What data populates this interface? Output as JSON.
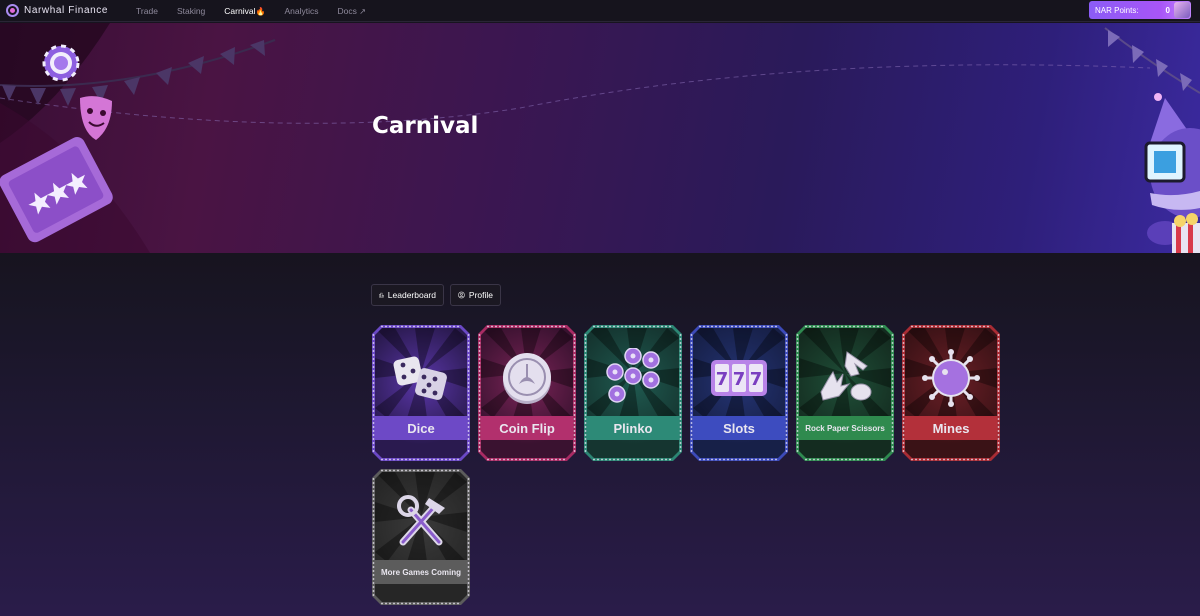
{
  "app": {
    "name": "Narwhal Finance"
  },
  "nav": {
    "links": [
      {
        "label": "Trade"
      },
      {
        "label": "Staking"
      },
      {
        "label": "Carnival"
      },
      {
        "label": "Analytics"
      },
      {
        "label": "Docs"
      }
    ],
    "active": "Carnival",
    "points_label": "NAR Points:",
    "points_value": "0"
  },
  "banner": {
    "title": "Carnival"
  },
  "actions": {
    "leaderboard": "Leaderboard",
    "profile": "Profile"
  },
  "games": [
    {
      "label": "Dice",
      "icon": "dice-icon",
      "color": "#7a4fd6"
    },
    {
      "label": "Coin Flip",
      "icon": "coin-icon",
      "color": "#b8306e"
    },
    {
      "label": "Plinko",
      "icon": "plinko-chips-icon",
      "color": "#2f8a78"
    },
    {
      "label": "Slots",
      "icon": "slot-machine-icon",
      "color": "#3b4ac0"
    },
    {
      "label": "Rock Paper Scissors",
      "icon": "hand-gestures-icon",
      "color": "#2f8a4e"
    },
    {
      "label": "Mines",
      "icon": "mine-icon",
      "color": "#b8303a"
    },
    {
      "label": "More Games Coming",
      "icon": "tools-icon",
      "color": "#5a5a5a"
    }
  ]
}
